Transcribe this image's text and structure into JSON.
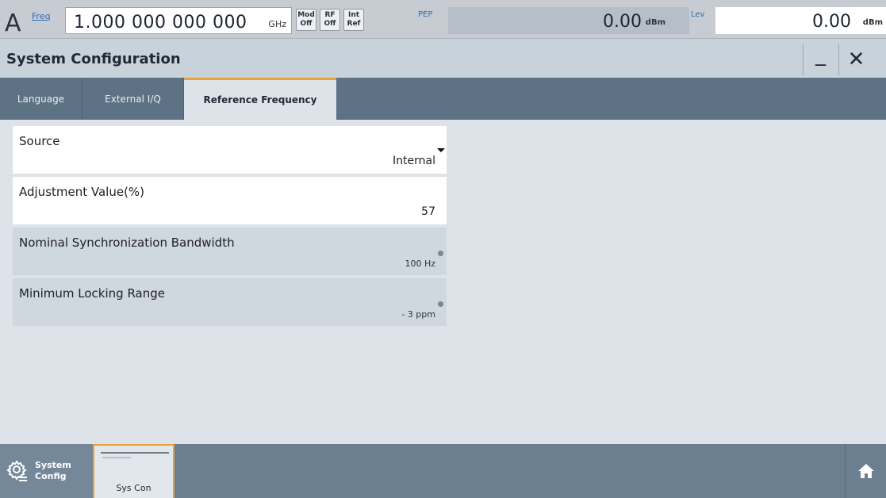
{
  "status_bar": {
    "channel": "A",
    "freq_label": "Freq",
    "freq_value": "1.000 000 000 000",
    "freq_unit": "GHz",
    "pills": [
      {
        "line1": "Mod",
        "line2": "Off"
      },
      {
        "line1": "RF",
        "line2": "Off"
      },
      {
        "line1": "Int",
        "line2": "Ref"
      }
    ],
    "pep_label": "PEP",
    "pep_value": "0.00",
    "pep_unit": "dBm",
    "lev_label": "Lev",
    "lev_value": "0.00",
    "lev_unit": "dBm"
  },
  "dialog": {
    "title": "System Configuration",
    "minimize_glyph": "_",
    "close_glyph": "✕"
  },
  "tabs": [
    {
      "label": "Language"
    },
    {
      "label": "External I/Q"
    },
    {
      "label": "Reference Frequency"
    }
  ],
  "fields": {
    "source": {
      "label": "Source",
      "value": "Internal"
    },
    "adjustment": {
      "label": "Adjustment Value(%)",
      "value": "57"
    },
    "sync_bandwidth": {
      "label": "Nominal Synchronization Bandwidth",
      "value": "100 Hz"
    },
    "locking_range": {
      "label": "Minimum Locking Range",
      "value": "- 3 ppm"
    }
  },
  "taskbar": {
    "system_line1": "System",
    "system_line2": "Config",
    "thumb_label": "Sys Con"
  },
  "colors": {
    "accent": "#e7a33a",
    "tabbar": "#5e7285",
    "taskbar": "#6c7f91"
  }
}
